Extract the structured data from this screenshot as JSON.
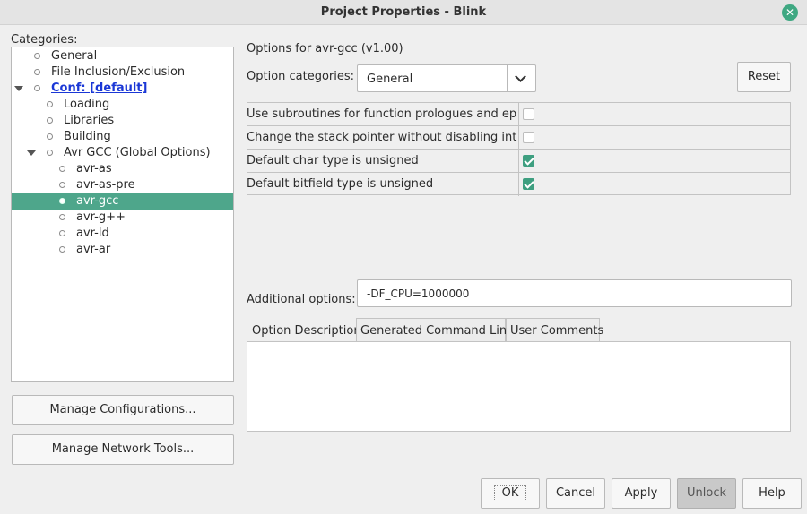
{
  "window": {
    "title": "Project Properties - Blink",
    "close_glyph": "✕"
  },
  "categories": {
    "label": "Categories:",
    "items": [
      {
        "label": "General"
      },
      {
        "label": "File Inclusion/Exclusion"
      },
      {
        "label": "Conf: [default]"
      },
      {
        "label": "Loading"
      },
      {
        "label": "Libraries"
      },
      {
        "label": "Building"
      },
      {
        "label": "Avr GCC (Global Options)"
      },
      {
        "label": "avr-as"
      },
      {
        "label": "avr-as-pre"
      },
      {
        "label": "avr-gcc"
      },
      {
        "label": "avr-g++"
      },
      {
        "label": "avr-ld"
      },
      {
        "label": "avr-ar"
      }
    ],
    "selected": "avr-gcc"
  },
  "left_buttons": {
    "manage_configurations": "Manage Configurations...",
    "manage_network_tools": "Manage Network Tools..."
  },
  "options": {
    "header": "Options for avr-gcc (v1.00)",
    "category_label": "Option categories:",
    "category_value": "General",
    "reset_label": "Reset",
    "rows": [
      {
        "name": "Use subroutines for function prologues and epil...",
        "checked": false
      },
      {
        "name": "Change the stack pointer without disabling inte...",
        "checked": false
      },
      {
        "name": "Default char type is unsigned",
        "checked": true
      },
      {
        "name": "Default bitfield type is unsigned",
        "checked": true
      }
    ],
    "additional_label": "Additional options:",
    "additional_value": "-DF_CPU=1000000"
  },
  "tabs": [
    {
      "label": "Option Description",
      "active": true
    },
    {
      "label": "Generated Command Line",
      "active": false
    },
    {
      "label": "User Comments",
      "active": false
    }
  ],
  "footer": {
    "ok": "OK",
    "cancel": "Cancel",
    "apply": "Apply",
    "unlock": "Unlock",
    "help": "Help"
  },
  "colors": {
    "accent": "#4ea68b",
    "link": "#1a37d6"
  }
}
